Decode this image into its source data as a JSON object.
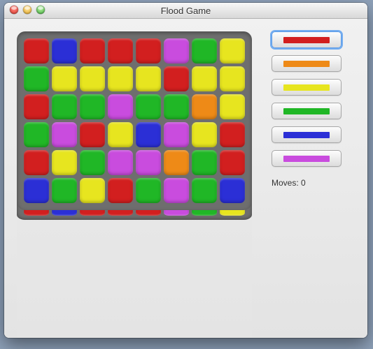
{
  "window": {
    "title": "Flood Game"
  },
  "colors": {
    "red": "#d21f1f",
    "orange": "#ee8a17",
    "yellow": "#e7e51f",
    "green": "#20b726",
    "blue": "#2b2fd6",
    "magenta": "#c94cde"
  },
  "board": {
    "cols": 8,
    "rows": 6,
    "grid": [
      [
        "red",
        "blue",
        "red",
        "red",
        "red",
        "magenta",
        "green",
        "yellow"
      ],
      [
        "green",
        "yellow",
        "yellow",
        "yellow",
        "yellow",
        "red",
        "yellow",
        "yellow"
      ],
      [
        "red",
        "green",
        "green",
        "magenta",
        "green",
        "green",
        "orange",
        "yellow"
      ],
      [
        "green",
        "magenta",
        "red",
        "yellow",
        "blue",
        "magenta",
        "yellow",
        "red"
      ],
      [
        "red",
        "yellow",
        "green",
        "magenta",
        "magenta",
        "orange",
        "green",
        "red"
      ],
      [
        "blue",
        "green",
        "yellow",
        "red",
        "green",
        "magenta",
        "green",
        "blue"
      ]
    ]
  },
  "palette": {
    "buttons": [
      "red",
      "orange",
      "yellow",
      "green",
      "blue",
      "magenta"
    ],
    "focused_index": 0
  },
  "moves": {
    "label_prefix": "Moves: ",
    "count": 0
  }
}
